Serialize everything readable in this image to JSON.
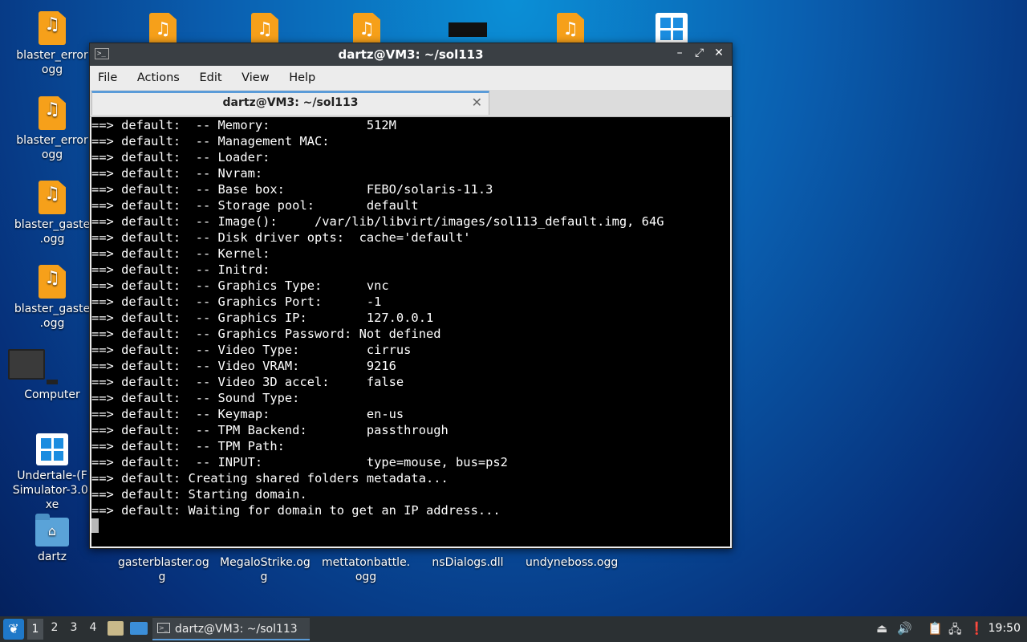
{
  "desktop": {
    "icons_left": [
      {
        "label": "blaster_error\nogg",
        "type": "music"
      },
      {
        "label": "blaster_error\nogg",
        "type": "music"
      },
      {
        "label": "blaster_gaste\n.ogg",
        "type": "music"
      },
      {
        "label": "blaster_gaste\n.ogg",
        "type": "music"
      },
      {
        "label": "Computer",
        "type": "computer"
      },
      {
        "label": "Undertale-(F\nSimulator-3.0.\nxe",
        "type": "windows-exe"
      },
      {
        "label": "dartz",
        "type": "home-folder"
      }
    ],
    "icons_bottom": [
      {
        "label": "gasterblaster.og\ng"
      },
      {
        "label": "MegaloStrike.og\ng"
      },
      {
        "label": "mettatonbattle.\nogg"
      },
      {
        "label": "nsDialogs.dll"
      },
      {
        "label": "undyneboss.ogg"
      }
    ]
  },
  "window": {
    "title": "dartz@VM3: ~/sol113",
    "menu": [
      "File",
      "Actions",
      "Edit",
      "View",
      "Help"
    ],
    "tab_label": "dartz@VM3: ~/sol113",
    "terminal_lines": [
      "==> default:  -- Memory:             512M",
      "==> default:  -- Management MAC:",
      "==> default:  -- Loader:",
      "==> default:  -- Nvram:",
      "==> default:  -- Base box:           FEBO/solaris-11.3",
      "==> default:  -- Storage pool:       default",
      "==> default:  -- Image():     /var/lib/libvirt/images/sol113_default.img, 64G",
      "==> default:  -- Disk driver opts:  cache='default'",
      "==> default:  -- Kernel:",
      "==> default:  -- Initrd:",
      "==> default:  -- Graphics Type:      vnc",
      "==> default:  -- Graphics Port:      -1",
      "==> default:  -- Graphics IP:        127.0.0.1",
      "==> default:  -- Graphics Password: Not defined",
      "==> default:  -- Video Type:         cirrus",
      "==> default:  -- Video VRAM:         9216",
      "==> default:  -- Video 3D accel:     false",
      "==> default:  -- Sound Type:",
      "==> default:  -- Keymap:             en-us",
      "==> default:  -- TPM Backend:        passthrough",
      "==> default:  -- TPM Path:",
      "==> default:  -- INPUT:              type=mouse, bus=ps2",
      "==> default: Creating shared folders metadata...",
      "==> default: Starting domain.",
      "==> default: Waiting for domain to get an IP address..."
    ]
  },
  "taskbar": {
    "workspaces": [
      "1",
      "2",
      "3",
      "4"
    ],
    "active_workspace": "1",
    "task_label": "dartz@VM3: ~/sol113",
    "clock": "19:50"
  }
}
